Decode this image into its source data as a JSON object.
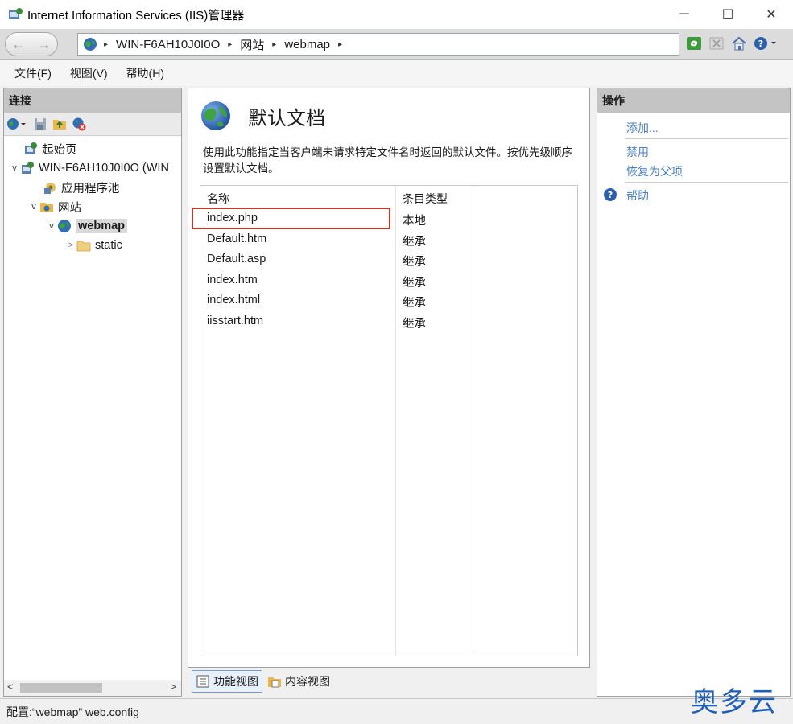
{
  "window": {
    "title": "Internet Information Services (IIS)管理器",
    "controls": {
      "minimize": "─",
      "maximize": "☐",
      "close": "✕"
    }
  },
  "address_bar": {
    "back": "←",
    "forward": "→",
    "crumbs": [
      "WIN-F6AH10J0I0O",
      "网站",
      "webmap"
    ],
    "separator": "▸"
  },
  "menu": {
    "items": [
      "文件(F)",
      "视图(V)",
      "帮助(H)"
    ]
  },
  "connections": {
    "header": "连接",
    "tree": [
      {
        "label": "起始页",
        "icon": "start-page-icon"
      },
      {
        "label": "WIN-F6AH10J0I0O (WIN",
        "icon": "server-icon",
        "expander": "v"
      },
      {
        "label": "应用程序池",
        "icon": "app-pool-icon"
      },
      {
        "label": "网站",
        "icon": "sites-folder-icon",
        "expander": "v"
      },
      {
        "label": "webmap",
        "icon": "globe-icon",
        "expander": "v",
        "selected": true
      },
      {
        "label": "static",
        "icon": "folder-icon",
        "expander": ">"
      }
    ],
    "scroll_left": "<",
    "scroll_right": ">"
  },
  "feature": {
    "title": "默认文档",
    "description": "使用此功能指定当客户端未请求特定文件名时返回的默认文件。按优先级顺序设置默认文档。",
    "columns": [
      "名称",
      "条目类型"
    ],
    "rows": [
      {
        "name": "index.php",
        "type": "本地"
      },
      {
        "name": "Default.htm",
        "type": "继承"
      },
      {
        "name": "Default.asp",
        "type": "继承"
      },
      {
        "name": "index.htm",
        "type": "继承"
      },
      {
        "name": "index.html",
        "type": "继承"
      },
      {
        "name": "iisstart.htm",
        "type": "继承"
      }
    ]
  },
  "view_tabs": {
    "features": "功能视图",
    "content": "内容视图"
  },
  "actions": {
    "header": "操作",
    "items": [
      "添加...",
      "禁用",
      "恢复为父项",
      "帮助"
    ]
  },
  "status": {
    "text": "配置:“webmap” web.config"
  },
  "watermark": "奥多云",
  "colors": {
    "highlight": "#c0392b",
    "link": "#4a7fc1",
    "header": "#c4c4c4"
  }
}
